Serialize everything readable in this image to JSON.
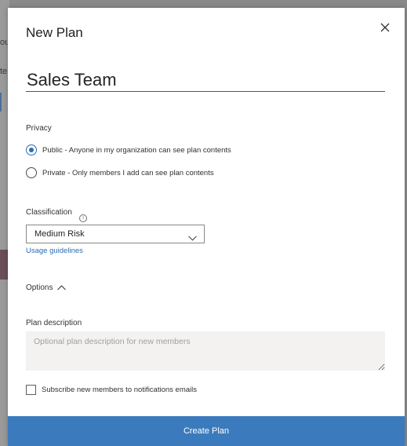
{
  "background": {
    "fragments": [
      "ou",
      "te"
    ]
  },
  "dialog": {
    "title": "New Plan",
    "close_icon": "close-icon",
    "plan_name": {
      "value": "Sales Team"
    },
    "privacy": {
      "label": "Privacy",
      "options": [
        {
          "label": "Public - Anyone in my organization can see plan contents",
          "checked": true
        },
        {
          "label": "Private - Only members I add can see plan contents",
          "checked": false
        }
      ]
    },
    "classification": {
      "label": "Classification",
      "info_icon": "info-icon",
      "selected": "Medium Risk",
      "dropdown_icon": "chevron-down-icon"
    },
    "usage_guidelines": "Usage guidelines",
    "options": {
      "label": "Options",
      "icon": "chevron-up-icon"
    },
    "plan_description": {
      "label": "Plan description",
      "placeholder": "Optional plan description for new members",
      "value": ""
    },
    "subscribe": {
      "label": "Subscribe new members to notifications emails",
      "checked": false
    },
    "create_button": "Create Plan"
  },
  "colors": {
    "accent": "#2b6cb0",
    "button": "#3b7bbd",
    "overlay": "#8a8a8a"
  }
}
